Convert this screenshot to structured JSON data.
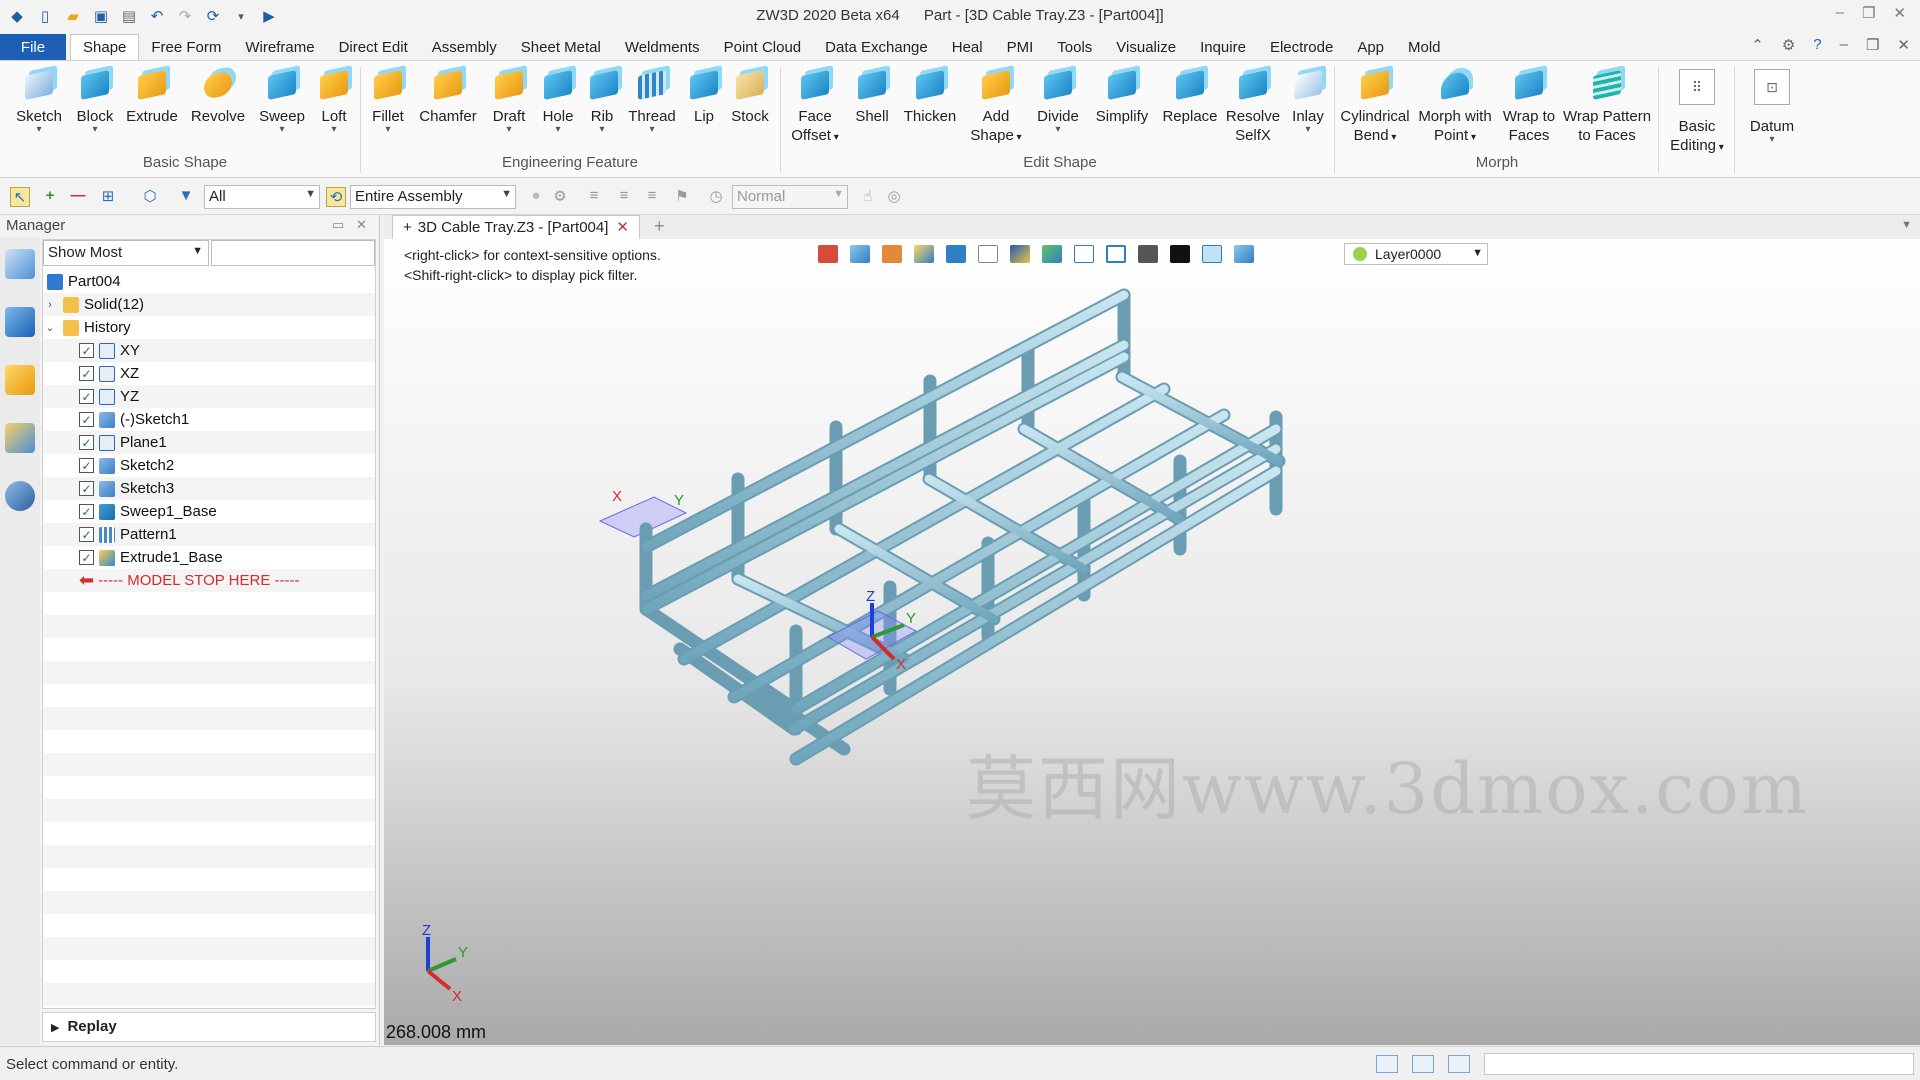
{
  "titlebar": {
    "app": "ZW3D 2020 Beta x64",
    "doc": "Part - [3D Cable Tray.Z3 - [Part004]]"
  },
  "menu": {
    "file": "File",
    "tabs": [
      "Shape",
      "Free Form",
      "Wireframe",
      "Direct Edit",
      "Assembly",
      "Sheet Metal",
      "Weldments",
      "Point Cloud",
      "Data Exchange",
      "Heal",
      "PMI",
      "Tools",
      "Visualize",
      "Inquire",
      "Electrode",
      "App",
      "Mold"
    ]
  },
  "ribbon": {
    "sketch": "Sketch",
    "block": "Block",
    "extrude": "Extrude",
    "revolve": "Revolve",
    "sweep": "Sweep",
    "loft": "Loft",
    "fillet": "Fillet",
    "chamfer": "Chamfer",
    "draft": "Draft",
    "hole": "Hole",
    "rib": "Rib",
    "thread": "Thread",
    "lip": "Lip",
    "stock": "Stock",
    "face_offset_1": "Face",
    "face_offset_2": "Offset",
    "shell": "Shell",
    "thicken": "Thicken",
    "add_shape_1": "Add",
    "add_shape_2": "Shape",
    "divide": "Divide",
    "simplify": "Simplify",
    "replace": "Replace",
    "resolve_1": "Resolve",
    "resolve_2": "SelfX",
    "inlay": "Inlay",
    "cyl_bend_1": "Cylindrical",
    "cyl_bend_2": "Bend",
    "morph_point_1": "Morph with",
    "morph_point_2": "Point",
    "wrap_faces_1": "Wrap to",
    "wrap_faces_2": "Faces",
    "wrap_pattern_1": "Wrap Pattern",
    "wrap_pattern_2": "to Faces",
    "basic_editing_1": "Basic",
    "basic_editing_2": "Editing",
    "datum": "Datum",
    "groups": {
      "basic_shape": "Basic Shape",
      "engineering_feature": "Engineering Feature",
      "edit_shape": "Edit Shape",
      "morph": "Morph"
    }
  },
  "filterbar": {
    "filter_value": "All",
    "scope_value": "Entire Assembly",
    "display_value": "Normal"
  },
  "manager": {
    "title": "Manager",
    "show_filter": "Show Most",
    "tree": {
      "root": "Part004",
      "solid": "Solid(12)",
      "history": "History",
      "items": [
        "XY",
        "XZ",
        "YZ",
        "(-)Sketch1",
        "Plane1",
        "Sketch2",
        "Sketch3",
        "Sweep1_Base",
        "Pattern1",
        "Extrude1_Base"
      ],
      "stop": "----- MODEL STOP HERE -----"
    },
    "replay": "Replay"
  },
  "document": {
    "tab": "3D Cable Tray.Z3 - [Part004]"
  },
  "viewport": {
    "hint1": "<right-click> for context-sensitive options.",
    "hint2": "<Shift-right-click> to display pick filter.",
    "layer": "Layer0000",
    "watermark": "莫西网www.3dmox.com",
    "scale": "268.008 mm",
    "axes": {
      "x": "X",
      "y": "Y",
      "z": "Z"
    }
  },
  "status": {
    "text": "Select command or entity."
  },
  "colors": {
    "accent": "#1c5fb4",
    "tube": "#a8d2e2",
    "tube_dark": "#5f96ad",
    "stop": "#d62b2b"
  }
}
